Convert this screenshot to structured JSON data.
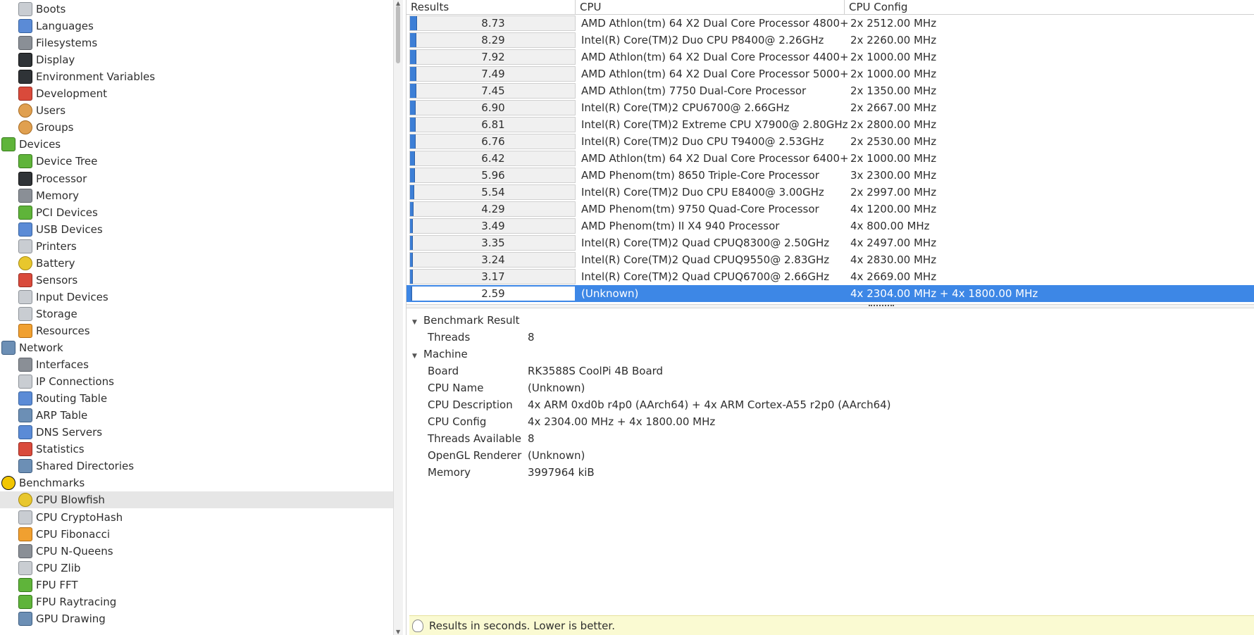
{
  "tree": [
    {
      "label": "Boots",
      "icon": "power-icon",
      "indent": 1
    },
    {
      "label": "Languages",
      "icon": "flag-icon",
      "indent": 1
    },
    {
      "label": "Filesystems",
      "icon": "folder-icon",
      "indent": 1
    },
    {
      "label": "Display",
      "icon": "monitor-icon",
      "indent": 1
    },
    {
      "label": "Environment Variables",
      "icon": "terminal-icon",
      "indent": 1
    },
    {
      "label": "Development",
      "icon": "toolbox-icon",
      "indent": 1
    },
    {
      "label": "Users",
      "icon": "users-icon",
      "indent": 1
    },
    {
      "label": "Groups",
      "icon": "group-icon",
      "indent": 1
    },
    {
      "label": "Devices",
      "icon": "board-icon",
      "indent": 0
    },
    {
      "label": "Device Tree",
      "icon": "board-icon",
      "indent": 1
    },
    {
      "label": "Processor",
      "icon": "chip-icon",
      "indent": 1
    },
    {
      "label": "Memory",
      "icon": "memory-icon",
      "indent": 1
    },
    {
      "label": "PCI Devices",
      "icon": "pci-card-icon",
      "indent": 1
    },
    {
      "label": "USB Devices",
      "icon": "usb-icon",
      "indent": 1
    },
    {
      "label": "Printers",
      "icon": "printer-icon",
      "indent": 1
    },
    {
      "label": "Battery",
      "icon": "battery-icon",
      "indent": 1
    },
    {
      "label": "Sensors",
      "icon": "thermometer-icon",
      "indent": 1
    },
    {
      "label": "Input Devices",
      "icon": "keyboard-icon",
      "indent": 1
    },
    {
      "label": "Storage",
      "icon": "disk-icon",
      "indent": 1
    },
    {
      "label": "Resources",
      "icon": "resources-icon",
      "indent": 1
    },
    {
      "label": "Network",
      "icon": "network-icon",
      "indent": 0
    },
    {
      "label": "Interfaces",
      "icon": "network-card-icon",
      "indent": 1
    },
    {
      "label": "IP Connections",
      "icon": "plug-icon",
      "indent": 1
    },
    {
      "label": "Routing Table",
      "icon": "routing-icon",
      "indent": 1
    },
    {
      "label": "ARP Table",
      "icon": "arp-icon",
      "indent": 1
    },
    {
      "label": "DNS Servers",
      "icon": "globe-icon",
      "indent": 1
    },
    {
      "label": "Statistics",
      "icon": "statistics-icon",
      "indent": 1
    },
    {
      "label": "Shared Directories",
      "icon": "shared-folder-icon",
      "indent": 1
    },
    {
      "label": "Benchmarks",
      "icon": "benchmark-icon",
      "indent": 0
    },
    {
      "label": "CPU Blowfish",
      "icon": "blowfish-icon",
      "indent": 1,
      "selected": true
    },
    {
      "label": "CPU CryptoHash",
      "icon": "key-icon",
      "indent": 1
    },
    {
      "label": "CPU Fibonacci",
      "icon": "shell-icon",
      "indent": 1
    },
    {
      "label": "CPU N-Queens",
      "icon": "chess-icon",
      "indent": 1
    },
    {
      "label": "CPU Zlib",
      "icon": "compress-icon",
      "indent": 1
    },
    {
      "label": "FPU FFT",
      "icon": "fft-icon",
      "indent": 1
    },
    {
      "label": "FPU Raytracing",
      "icon": "raytrace-icon",
      "indent": 1
    },
    {
      "label": "GPU Drawing",
      "icon": "gpu-icon",
      "indent": 1
    }
  ],
  "table": {
    "headers": {
      "results": "Results",
      "cpu": "CPU",
      "config": "CPU Config"
    },
    "max_value": 8.73,
    "rows": [
      {
        "result": "8.73",
        "value": 8.73,
        "cpu": "AMD Athlon(tm) 64 X2 Dual Core Processor 4800+",
        "config": "2x 2512.00 MHz"
      },
      {
        "result": "8.29",
        "value": 8.29,
        "cpu": "Intel(R) Core(TM)2 Duo CPU P8400@ 2.26GHz",
        "config": "2x 2260.00 MHz"
      },
      {
        "result": "7.92",
        "value": 7.92,
        "cpu": "AMD Athlon(tm) 64 X2 Dual Core Processor 4400+",
        "config": "2x 1000.00 MHz"
      },
      {
        "result": "7.49",
        "value": 7.49,
        "cpu": "AMD Athlon(tm) 64 X2 Dual Core Processor 5000+",
        "config": "2x 1000.00 MHz"
      },
      {
        "result": "7.45",
        "value": 7.45,
        "cpu": "AMD Athlon(tm) 7750 Dual-Core Processor",
        "config": "2x 1350.00 MHz"
      },
      {
        "result": "6.90",
        "value": 6.9,
        "cpu": "Intel(R) Core(TM)2 CPU6700@ 2.66GHz",
        "config": "2x 2667.00 MHz"
      },
      {
        "result": "6.81",
        "value": 6.81,
        "cpu": "Intel(R) Core(TM)2 Extreme CPU X7900@ 2.80GHz",
        "config": "2x 2800.00 MHz"
      },
      {
        "result": "6.76",
        "value": 6.76,
        "cpu": "Intel(R) Core(TM)2 Duo CPU T9400@ 2.53GHz",
        "config": "2x 2530.00 MHz"
      },
      {
        "result": "6.42",
        "value": 6.42,
        "cpu": "AMD Athlon(tm) 64 X2 Dual Core Processor 6400+",
        "config": "2x 1000.00 MHz"
      },
      {
        "result": "5.96",
        "value": 5.96,
        "cpu": "AMD Phenom(tm) 8650 Triple-Core Processor",
        "config": "3x 2300.00 MHz"
      },
      {
        "result": "5.54",
        "value": 5.54,
        "cpu": "Intel(R) Core(TM)2 Duo CPU E8400@ 3.00GHz",
        "config": "2x 2997.00 MHz"
      },
      {
        "result": "4.29",
        "value": 4.29,
        "cpu": "AMD Phenom(tm) 9750 Quad-Core Processor",
        "config": "4x 1200.00 MHz"
      },
      {
        "result": "3.49",
        "value": 3.49,
        "cpu": "AMD Phenom(tm) II X4 940 Processor",
        "config": "4x 800.00 MHz"
      },
      {
        "result": "3.35",
        "value": 3.35,
        "cpu": "Intel(R) Core(TM)2 Quad CPUQ8300@ 2.50GHz",
        "config": "4x 2497.00 MHz"
      },
      {
        "result": "3.24",
        "value": 3.24,
        "cpu": "Intel(R) Core(TM)2 Quad CPUQ9550@ 2.83GHz",
        "config": "4x 2830.00 MHz"
      },
      {
        "result": "3.17",
        "value": 3.17,
        "cpu": "Intel(R) Core(TM)2 Quad CPUQ6700@ 2.66GHz",
        "config": "4x 2669.00 MHz"
      },
      {
        "result": "2.59",
        "value": 2.59,
        "cpu": "(Unknown)",
        "config": "4x 2304.00 MHz + 4x 1800.00 MHz",
        "selected": true
      }
    ]
  },
  "details": {
    "benchmark_section": "Benchmark Result",
    "benchmark_fields": [
      {
        "key": "Threads",
        "value": "8"
      }
    ],
    "machine_section": "Machine",
    "machine_fields": [
      {
        "key": "Board",
        "value": "RK3588S CoolPi 4B Board"
      },
      {
        "key": "CPU Name",
        "value": "(Unknown)"
      },
      {
        "key": "CPU Description",
        "value": "4x ARM 0xd0b r4p0 (AArch64) + 4x ARM Cortex-A55 r2p0 (AArch64)"
      },
      {
        "key": "CPU Config",
        "value": "4x 2304.00 MHz + 4x 1800.00 MHz"
      },
      {
        "key": "Threads Available",
        "value": "8"
      },
      {
        "key": "OpenGL Renderer",
        "value": "(Unknown)"
      },
      {
        "key": "Memory",
        "value": "3997964 kiB"
      }
    ]
  },
  "hint": "Results in seconds. Lower is better.",
  "colors": {
    "accent": "#3d87e6",
    "bar": "#3d7fd6",
    "hint_bg": "#fafad2"
  }
}
